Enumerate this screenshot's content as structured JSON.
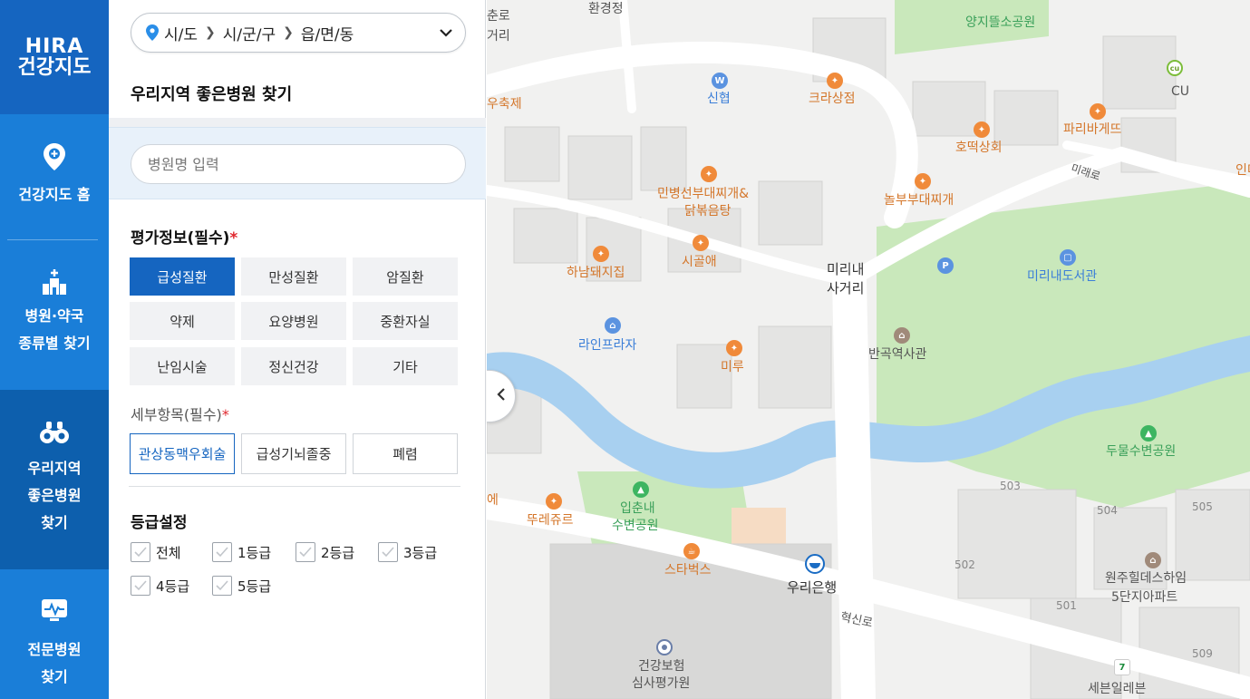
{
  "nav": {
    "logo_line1": "HIRA",
    "logo_line2": "건강지도",
    "items": [
      {
        "label": "건강지도 홈"
      },
      {
        "label": "병원·약국\n종류별 찾기"
      },
      {
        "label": "우리지역\n좋은병원\n찾기"
      },
      {
        "label": "전문병원\n찾기"
      }
    ]
  },
  "region": {
    "sido": "시/도",
    "sigungu": "시/군/구",
    "dong": "읍/면/동"
  },
  "panel": {
    "title": "우리지역 좋은병원 찾기",
    "search_placeholder": "병원명 입력",
    "eval_title": "평가정보(필수)",
    "eval_required": "*",
    "eval_buttons": [
      "급성질환",
      "만성질환",
      "암질환",
      "약제",
      "요양병원",
      "중환자실",
      "난임시술",
      "정신건강",
      "기타"
    ],
    "sub_title": "세부항목(필수)",
    "sub_required": "*",
    "sub_buttons": [
      "관상동맥우회술",
      "급성기뇌졸중",
      "폐렴"
    ],
    "grade_title": "등급설정",
    "grades": [
      "전체",
      "1등급",
      "2등급",
      "3등급",
      "4등급",
      "5등급"
    ]
  },
  "colors": {
    "nav_bg": "#1a7ed8",
    "primary": "#1565c0",
    "required": "#e0282e",
    "river": "#a8d0f0",
    "park": "#c5e8b7"
  },
  "map": {
    "labels": [
      "환경정",
      "춘로",
      "거리",
      "양지뜰소공원",
      "CU",
      "신협",
      "크라상점",
      "우축제",
      "파리바게뜨",
      "호떡상회",
      "인더",
      "미래로",
      "민병선부대찌개&",
      "닭볶음탕",
      "놀부부대찌개",
      "시골애",
      "하남돼지집",
      "미리내",
      "사거리",
      "미리내도서관",
      "라인프라자",
      "미루",
      "반곡역사관",
      "두물수변공원",
      "입춘내",
      "수변공원",
      "뚜레쥬르",
      "에",
      "스타벅스",
      "우리은행",
      "혁신로",
      "503",
      "504",
      "505",
      "502",
      "501",
      "509",
      "원주힐데스하임",
      "5단지아파트",
      "건강보험",
      "심사평가원",
      "세븐일레븐"
    ]
  }
}
